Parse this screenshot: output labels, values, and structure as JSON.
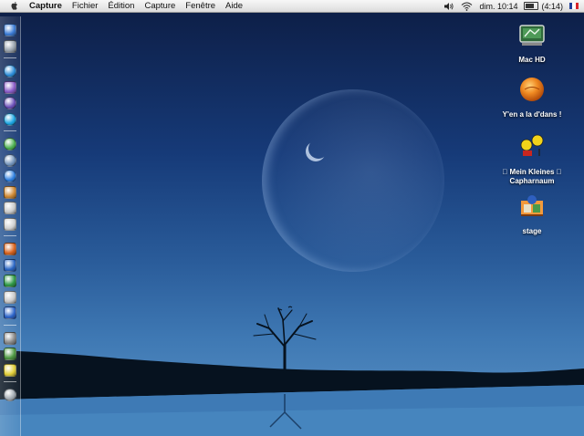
{
  "menubar": {
    "app_name": "Capture",
    "items": [
      "Fichier",
      "Édition",
      "Capture",
      "Fenêtre",
      "Aide"
    ],
    "clock": "dim. 10:14",
    "battery": "(4:14)",
    "battery_level": 0.7,
    "icons": [
      "apple-icon",
      "volume-icon",
      "wifi-icon",
      "battery-icon",
      "flag-fr-icon"
    ]
  },
  "dock": {
    "icons": [
      "finder-icon",
      "mac-icon",
      "safari-icon",
      "mail-icon",
      "chat-icon",
      "skype-icon",
      "itunes-icon",
      "dvd-icon",
      "web-icon",
      "picture-icon",
      "ipod-icon",
      "keychain-icon",
      "powerpoint-icon",
      "word-icon",
      "excel-icon",
      "textedit-icon",
      "zip-icon",
      "mail-app-icon",
      "preview-icon",
      "stickies-icon",
      "trash-icon"
    ]
  },
  "desktop": {
    "icons": [
      {
        "label": "Mac HD",
        "icon": "hard-drive-icon"
      },
      {
        "label": "Y'en a la d'dans !",
        "icon": "orange-ball-icon"
      },
      {
        "label": "Mein Kleines",
        "label2": "Capharnaum",
        "icon": "folder-icon"
      },
      {
        "label": "stage",
        "icon": "stage-icon"
      }
    ]
  },
  "colors": {
    "sky_top": "#0d1d44",
    "sky_bottom": "#5d94c6",
    "menubar": "#e8e8e8"
  }
}
